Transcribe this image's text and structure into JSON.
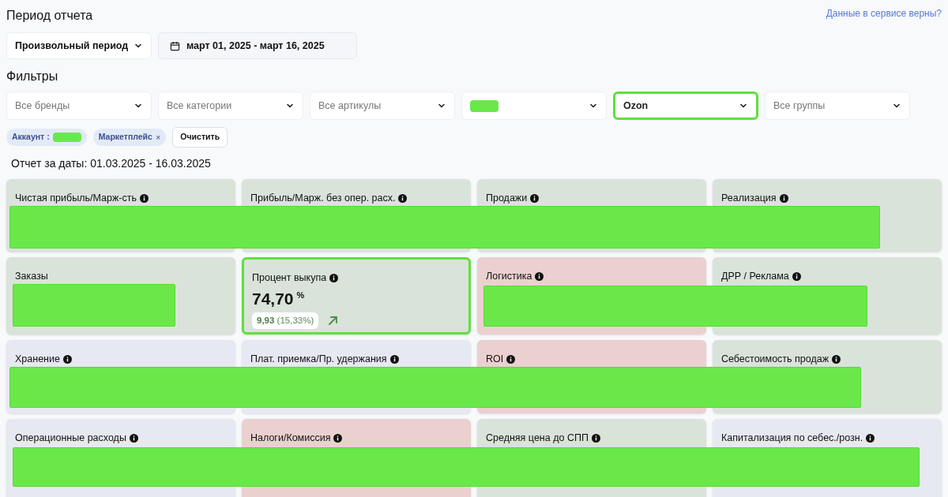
{
  "period": {
    "heading": "Период отчета",
    "preset": "Произвольный период",
    "range": "март 01, 2025 - март 16, 2025"
  },
  "help_link": "Данные в сервисе верны?",
  "filters": {
    "heading": "Фильтры",
    "dropdowns": [
      {
        "text": "Все бренды",
        "kind": "placeholder",
        "highlighted": false
      },
      {
        "text": "Все категории",
        "kind": "placeholder",
        "highlighted": false
      },
      {
        "text": "Все артикулы",
        "kind": "placeholder",
        "highlighted": false
      },
      {
        "kind": "redacted",
        "highlighted": false
      },
      {
        "text": "Ozon",
        "kind": "value",
        "highlighted": true
      },
      {
        "text": "Все группы",
        "kind": "placeholder",
        "highlighted": false
      }
    ],
    "chips": [
      {
        "label": "Аккаунт :",
        "kind": "redacted"
      },
      {
        "label": "Маркетплейс",
        "kind": "removable",
        "remove": "×"
      }
    ],
    "clear_button": "Очистить"
  },
  "report_title": "Отчет за даты: 01.03.2025 - 16.03.2025",
  "cards": [
    [
      {
        "title": "Чистая прибыль/Марж-сть",
        "info": true,
        "color": "#d9e3da",
        "highlighted": false
      },
      {
        "title": "Прибыль/Марж. без опер. расх.",
        "info": true,
        "color": "#d9e3da",
        "highlighted": false
      },
      {
        "title": "Продажи",
        "info": true,
        "color": "#d9e3da",
        "highlighted": false
      },
      {
        "title": "Реализация",
        "info": true,
        "color": "#d9e3da",
        "highlighted": false
      }
    ],
    [
      {
        "title": "Заказы",
        "info": false,
        "color": "#d9e3da",
        "highlighted": false
      },
      {
        "title": "Процент выкупа",
        "info": true,
        "color": "#d9e3da",
        "highlighted": true,
        "value": "74,70",
        "unit": "%",
        "delta": "9,93",
        "delta_pct": "(15,33%)",
        "rising": true
      },
      {
        "title": "Логистика",
        "info": true,
        "color": "#ebd0d0",
        "highlighted": false
      },
      {
        "title": "ДРР / Реклама",
        "info": true,
        "color": "#d9e3da",
        "highlighted": false
      }
    ],
    [
      {
        "title": "Хранение",
        "info": true,
        "color": "#e6e9f1",
        "highlighted": false
      },
      {
        "title": "Плат. приемка/Пр. удержания",
        "info": true,
        "color": "#e6e9f1",
        "highlighted": false
      },
      {
        "title": "ROI",
        "info": true,
        "color": "#ebd0d0",
        "highlighted": false
      },
      {
        "title": "Себестоимость продаж",
        "info": true,
        "color": "#d9e3da",
        "highlighted": false
      }
    ],
    [
      {
        "title": "Операционные расходы",
        "info": true,
        "color": "#e6e9f1",
        "highlighted": false
      },
      {
        "title": "Налоги/Комиссия",
        "info": true,
        "color": "#ebd0d0",
        "highlighted": false
      },
      {
        "title": "Средняя цена до СПП",
        "info": true,
        "color": "#d9e3da",
        "highlighted": false
      },
      {
        "title": "Капитализация по себес./розн.",
        "info": true,
        "color": "#e6e9f1",
        "highlighted": false
      }
    ]
  ]
}
